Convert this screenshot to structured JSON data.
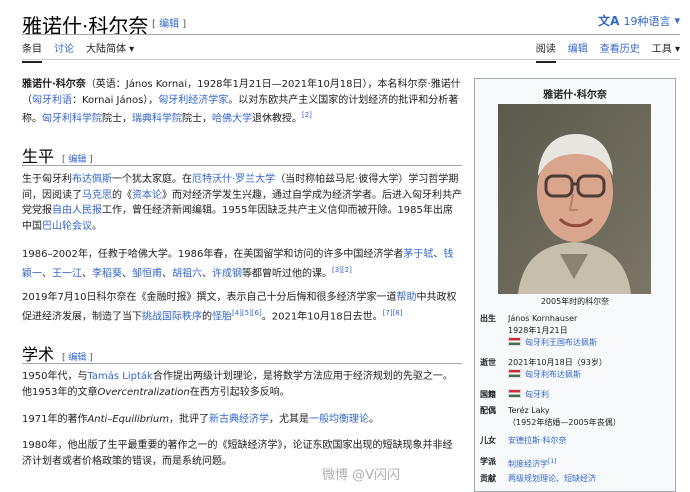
{
  "header": {
    "title": "雅诺什·科尔奈",
    "edit_label": "编辑",
    "languages": "19种语言",
    "lang_icon": "文A"
  },
  "tabs_left": [
    {
      "label": "条目",
      "active": true
    },
    {
      "label": "讨论",
      "active": false
    },
    {
      "label": "大陆简体 ▾",
      "active": false
    }
  ],
  "tabs_right": [
    {
      "label": "阅读",
      "active": true
    },
    {
      "label": "编辑",
      "active": false
    },
    {
      "label": "查看历史",
      "active": false
    },
    {
      "label": "工具 ▾",
      "active": false
    }
  ],
  "intro": {
    "text1": "雅诺什·科尔奈",
    "text2": "（英语：János Kornai，1928年1月21日—2021年10月18日），本名科尔奈·雅诺什（",
    "link1": "匈牙利语",
    "text3": "：Kornai János），",
    "link2": "匈牙利经济学家",
    "text4": "。以对东欧共产主义国家的计划经济的批评和分析著称。",
    "link3": "匈牙利科学院",
    "text5": "院士，",
    "link4": "瑞典科学院",
    "text6": "院士，",
    "link5": "哈佛大学",
    "text7": "退休教授。",
    "ref": "[2]"
  },
  "section_life": {
    "heading": "生平",
    "edit": "编辑",
    "p1": {
      "a": "生于匈牙利",
      "l1": "布达佩斯",
      "b": "一个犹太家庭。在",
      "l2": "厄特沃什·罗兰大学",
      "c": "（当时称帕兹马尼·彼得大学）学习哲学期间，因阅读了",
      "l3": "马克思",
      "d": "的《",
      "l4": "资本论",
      "e": "》而对经济学发生兴趣，通过自学成为经济学者。后进入匈牙利共产党党报",
      "l5": "自由人民报",
      "f": "工作，曾任经济新闻编辑。1955年因缺乏共产主义信仰而被开除。1985年出席中国",
      "l6": "巴山轮会议",
      "g": "。"
    },
    "p2": {
      "a": "1986–2002年，任教于哈佛大学。1986年春，在美国留学和访问的许多中国经济学者",
      "l1": "茅于轼",
      "s1": "、",
      "l2": "钱颖一",
      "s2": "、",
      "l3": "王一江",
      "s3": "、",
      "l4": "李稻葵",
      "s4": "、",
      "l5": "邹恒甫",
      "s5": "、",
      "l6": "胡祖六",
      "s6": "、",
      "l7": "许成钢",
      "b": "等都曾听过他的课。",
      "ref": "[3][2]"
    },
    "p3": {
      "a": "2019年7月10日科尔奈在《金融时报》撰文，表示自己十分后悔和很多经济学家一道",
      "l1": "帮助",
      "b": "中共政权促进经济发展，制造了当下",
      "l2": "挑战国际秩序",
      "c": "的",
      "l3": "怪胎",
      "ref1": "[4][5][6]",
      "d": "。2021年10月18日去世。",
      "ref2": "[7][8]"
    }
  },
  "section_academic": {
    "heading": "学术",
    "edit": "编辑",
    "p1": {
      "a": "1950年代，与",
      "l1": "Tamás Lipták",
      "b": "合作提出两级计划理论，是将数学方法应用于经济规划的先驱之一。他1953年的文章",
      "i1": "Overcentralization",
      "c": "在西方引起较多反响。"
    },
    "p2": {
      "a": "1971年的著作",
      "i1": "Anti–Equilibrium",
      "b": "，批评了",
      "l1": "新古典经济学",
      "c": "，尤其是",
      "l2": "一般均衡理论",
      "d": "。"
    },
    "p3": {
      "a": "1980年，他出版了生平最重要的著作之一的《短缺经济学》，论证东欧国家出现的短缺现象并非经济计划者或者价格政策的错误，而是系统问题。"
    }
  },
  "infobox": {
    "title": "雅诺什·科尔奈",
    "caption": "2005年时的科尔奈",
    "born_label": "出生",
    "born_name": "János Kornhauser",
    "born_date": "1928年1月21日",
    "born_place": "匈牙利王国布达佩斯",
    "died_label": "逝世",
    "died_date": "2021年10月18日（93岁）",
    "died_place": "匈牙利布达佩斯",
    "nation_label": "国籍",
    "nation": "匈牙利",
    "spouse_label": "配偶",
    "spouse_name": "Teréz Laky",
    "spouse_years": "（1952年结婚—2005年丧偶）",
    "children_label": "儿女",
    "children": "安德拉斯·科尔奈",
    "school_label": "学派",
    "school": "制度经济学",
    "school_ref": "[1]",
    "contrib_label": "贡献",
    "contrib": "两级规划理论、短缺经济"
  },
  "watermark": "微博 @V闪闪",
  "colors": {
    "link": "#3366cc",
    "text": "#202122",
    "infobox_bg": "#f8f9fa",
    "border": "#a2a9b1"
  }
}
